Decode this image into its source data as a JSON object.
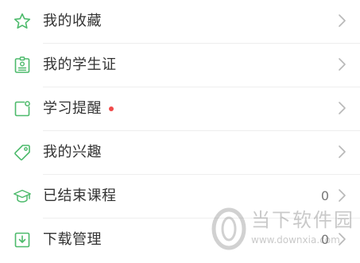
{
  "theme": {
    "accent": "#4cba6b",
    "text": "#333333",
    "secondary_text": "#777777",
    "chevron": "#b8b8b8",
    "divider": "#eeeeee",
    "badge_dot": "#f04a4a"
  },
  "menu": {
    "items": [
      {
        "label": "我的收藏",
        "icon": "star-icon"
      },
      {
        "label": "我的学生证",
        "icon": "student-id-icon"
      },
      {
        "label": "学习提醒",
        "icon": "reminder-icon",
        "has_dot": true
      },
      {
        "label": "我的兴趣",
        "icon": "tag-icon"
      },
      {
        "label": "已结束课程",
        "icon": "graduation-cap-icon",
        "count": "0"
      },
      {
        "label": "下载管理",
        "icon": "download-icon",
        "count": "0"
      }
    ]
  },
  "watermark": {
    "cn": "当下软件园",
    "en": "www.downxia.com"
  }
}
